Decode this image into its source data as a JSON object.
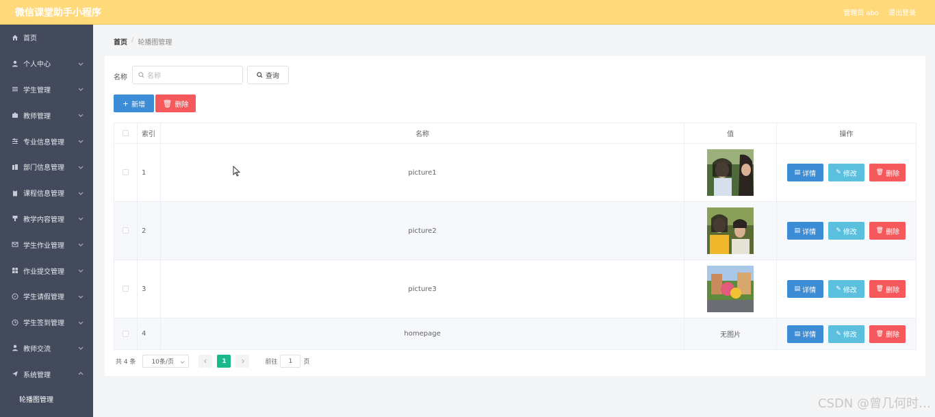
{
  "header": {
    "title": "微信课堂助手小程序",
    "user": "管理员 abo",
    "logout": "退出登录",
    "bg_color": "#ffd97a"
  },
  "sidebar": {
    "bg_color": "#434a5c",
    "items": [
      {
        "label": "首页",
        "icon": "home-icon"
      },
      {
        "label": "个人中心",
        "icon": "user-icon"
      },
      {
        "label": "学生管理",
        "icon": "list-icon"
      },
      {
        "label": "教师管理",
        "icon": "briefcase-icon"
      },
      {
        "label": "专业信息管理",
        "icon": "sliders-icon"
      },
      {
        "label": "部门信息管理",
        "icon": "building-icon"
      },
      {
        "label": "课程信息管理",
        "icon": "clipboard-icon"
      },
      {
        "label": "教学内容管理",
        "icon": "podium-icon"
      },
      {
        "label": "学生作业管理",
        "icon": "mail-icon"
      },
      {
        "label": "作业提交管理",
        "icon": "grid-icon"
      },
      {
        "label": "学生请假管理",
        "icon": "compass-icon"
      },
      {
        "label": "学生签到管理",
        "icon": "clock-icon"
      },
      {
        "label": "教师交流",
        "icon": "user-icon"
      },
      {
        "label": "系统管理",
        "icon": "send-icon"
      }
    ],
    "sub_item": "轮播图管理"
  },
  "breadcrumb": {
    "home": "首页",
    "separator": "/",
    "current": "轮播图管理"
  },
  "search": {
    "label": "名称",
    "placeholder": "名称",
    "query_button": "查询"
  },
  "toolbar": {
    "add_label": "新增",
    "delete_label": "删除"
  },
  "table": {
    "columns": [
      "索引",
      "名称",
      "值",
      "操作"
    ],
    "rows": [
      {
        "index": "1",
        "name": "picture1",
        "value": "image"
      },
      {
        "index": "2",
        "name": "picture2",
        "value": "image"
      },
      {
        "index": "3",
        "name": "picture3",
        "value": "image"
      },
      {
        "index": "4",
        "name": "homepage",
        "value": "无图片"
      }
    ],
    "actions": {
      "detail": "详情",
      "edit": "修改",
      "delete": "删除"
    }
  },
  "pagination": {
    "total": "共 4 条",
    "page_size": "10条/页",
    "current_page": "1",
    "goto_label": "前往",
    "goto_value": "1",
    "page_suffix": "页"
  },
  "watermark": "CSDN @曾几何时…"
}
